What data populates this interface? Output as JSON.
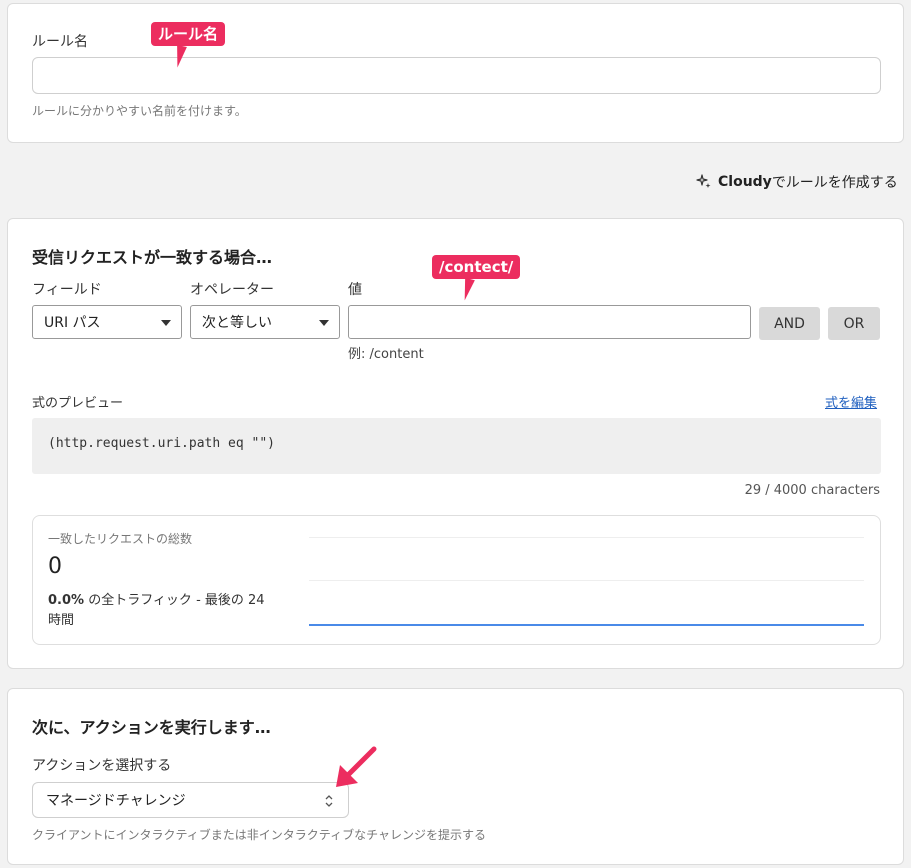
{
  "rule_name_section": {
    "label": "ルール名",
    "input_value": "",
    "help": "ルールに分かりやすい名前を付けます。",
    "callout": "ルール名"
  },
  "cloudy_link": {
    "icon": "sparkle-icon",
    "brand": "Cloudy",
    "text": " でルールを作成する"
  },
  "match_section": {
    "heading": "受信リクエストが一致する場合…",
    "field": {
      "label": "フィールド",
      "value": "URI パス"
    },
    "operator": {
      "label": "オペレーター",
      "value": "次と等しい"
    },
    "value": {
      "label": "値",
      "input_value": "",
      "example": "例: /content",
      "callout": "/contect/"
    },
    "and_button": "AND",
    "or_button": "OR",
    "preview": {
      "label": "式のプレビュー",
      "edit_link": "式を編集",
      "expression": "(http.request.uri.path eq \"\")",
      "char_count": "29 / 4000 characters"
    },
    "stats": {
      "title": "一致したリクエストの総数",
      "count": "0",
      "percent": "0.0%",
      "desc": " の全トラフィック - 最後の 24",
      "desc2": "時間",
      "accent_color": "#4a8ae8"
    }
  },
  "action_section": {
    "heading": "次に、アクションを実行します…",
    "label": "アクションを選択する",
    "selected": "マネージドチャレンジ",
    "help": "クライアントにインタラクティブまたは非インタラクティブなチャレンジを提示する"
  },
  "colors": {
    "callout": "#ec2d5f",
    "link": "#1f5fbf"
  }
}
